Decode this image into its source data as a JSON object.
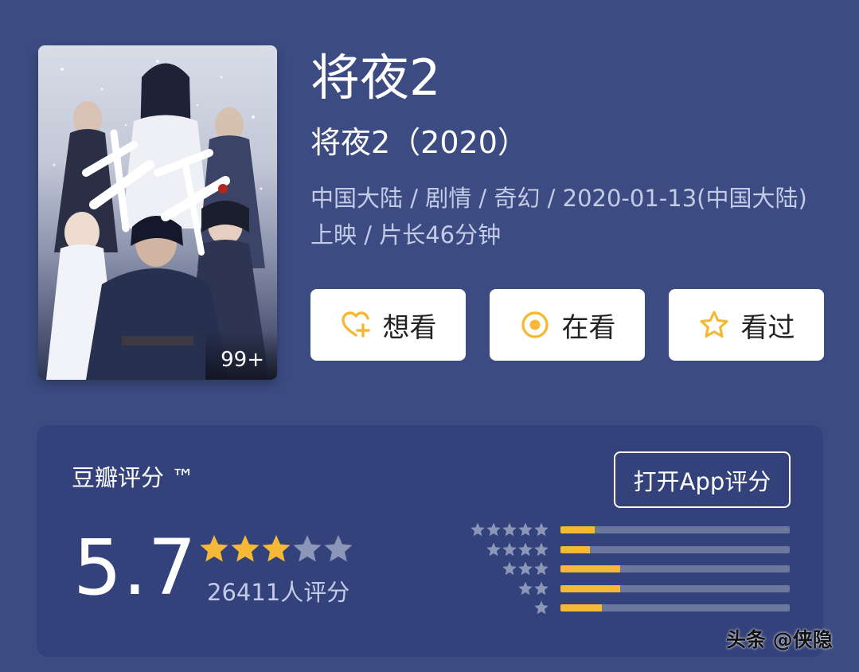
{
  "movie": {
    "title": "将夜2",
    "subtitle": "将夜2（2020）",
    "meta": "中国大陆 / 剧情 / 奇幻 / 2020-01-13(中国大陆)上映 / 片长46分钟",
    "poster_badge": "99+",
    "poster_title_art": "将夜"
  },
  "actions": {
    "want": {
      "label": "想看",
      "icon": "heart-plus-icon"
    },
    "watching": {
      "label": "在看",
      "icon": "target-circle-icon"
    },
    "watched": {
      "label": "看过",
      "icon": "star-outline-icon"
    }
  },
  "rating": {
    "title": "豆瓣评分 ™",
    "open_app": "打开App评分",
    "score": "5.7",
    "stars_filled": 3,
    "stars_total": 5,
    "count": "26411人评分",
    "distribution": [
      {
        "stars": 5,
        "fraction": 0.15
      },
      {
        "stars": 4,
        "fraction": 0.13
      },
      {
        "stars": 3,
        "fraction": 0.26
      },
      {
        "stars": 2,
        "fraction": 0.26
      },
      {
        "stars": 1,
        "fraction": 0.18
      }
    ]
  },
  "watermark": "头条 @侠隐",
  "colors": {
    "background": "#3c4c82",
    "panel": "#33427a",
    "accent": "#f6b936",
    "muted_text": "#c3cbe6",
    "star_empty": "#8c96b8",
    "bar_track": "#6c779d"
  }
}
